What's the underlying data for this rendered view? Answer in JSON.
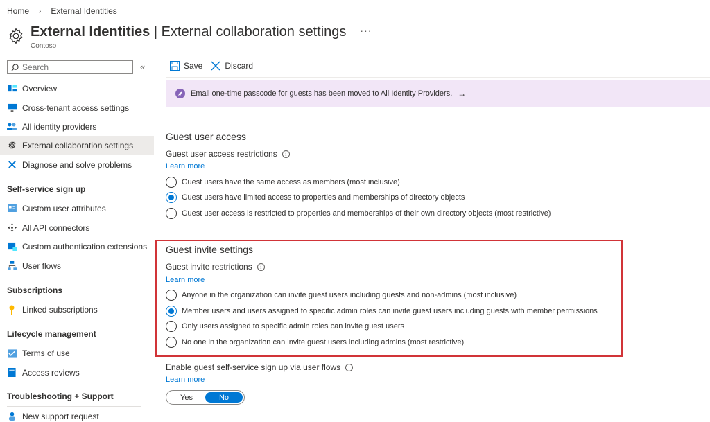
{
  "breadcrumb": {
    "home": "Home",
    "current": "External Identities"
  },
  "header": {
    "title_main": "External Identities",
    "title_rest": " | External collaboration settings",
    "more": "···",
    "subtitle": "Contoso"
  },
  "sidebar": {
    "search_placeholder": "Search",
    "collapse": "«",
    "items": [
      {
        "label": "Overview",
        "icon": "overview-icon"
      },
      {
        "label": "Cross-tenant access settings",
        "icon": "monitor-icon"
      },
      {
        "label": "All identity providers",
        "icon": "users-icon"
      },
      {
        "label": "External collaboration settings",
        "icon": "gear-icon",
        "active": true
      },
      {
        "label": "Diagnose and solve problems",
        "icon": "wrench-icon"
      }
    ],
    "section_selfservice": "Self-service sign up",
    "selfservice_items": [
      {
        "label": "Custom user attributes",
        "icon": "attributes-icon"
      },
      {
        "label": "All API connectors",
        "icon": "connector-icon"
      },
      {
        "label": "Custom authentication extensions",
        "icon": "extension-icon"
      },
      {
        "label": "User flows",
        "icon": "flow-icon"
      }
    ],
    "section_subscriptions": "Subscriptions",
    "subscriptions_items": [
      {
        "label": "Linked subscriptions",
        "icon": "key-icon"
      }
    ],
    "section_lifecycle": "Lifecycle management",
    "lifecycle_items": [
      {
        "label": "Terms of use",
        "icon": "checklist-icon"
      },
      {
        "label": "Access reviews",
        "icon": "book-icon"
      }
    ],
    "section_troubleshooting": "Troubleshooting + Support",
    "troubleshooting_items": [
      {
        "label": "New support request",
        "icon": "support-icon"
      }
    ]
  },
  "toolbar": {
    "save": "Save",
    "discard": "Discard"
  },
  "banner": {
    "text": "Email one-time passcode for guests has been moved to All Identity Providers.",
    "arrow": "→"
  },
  "guest_access": {
    "title": "Guest user access",
    "label": "Guest user access restrictions",
    "learn_more": "Learn more",
    "options": [
      "Guest users have the same access as members (most inclusive)",
      "Guest users have limited access to properties and memberships of directory objects",
      "Guest user access is restricted to properties and memberships of their own directory objects (most restrictive)"
    ],
    "selected": 1
  },
  "guest_invite": {
    "title": "Guest invite settings",
    "label": "Guest invite restrictions",
    "learn_more": "Learn more",
    "options": [
      "Anyone in the organization can invite guest users including guests and non-admins (most inclusive)",
      "Member users and users assigned to specific admin roles can invite guest users including guests with member permissions",
      "Only users assigned to specific admin roles can invite guest users",
      "No one in the organization can invite guest users including admins (most restrictive)"
    ],
    "selected": 1
  },
  "self_service": {
    "label": "Enable guest self-service sign up via user flows",
    "learn_more": "Learn more",
    "yes": "Yes",
    "no": "No",
    "value": "No"
  },
  "colors": {
    "accent": "#0078d4",
    "highlight": "#d13438",
    "banner_bg": "#f2e6f7"
  }
}
